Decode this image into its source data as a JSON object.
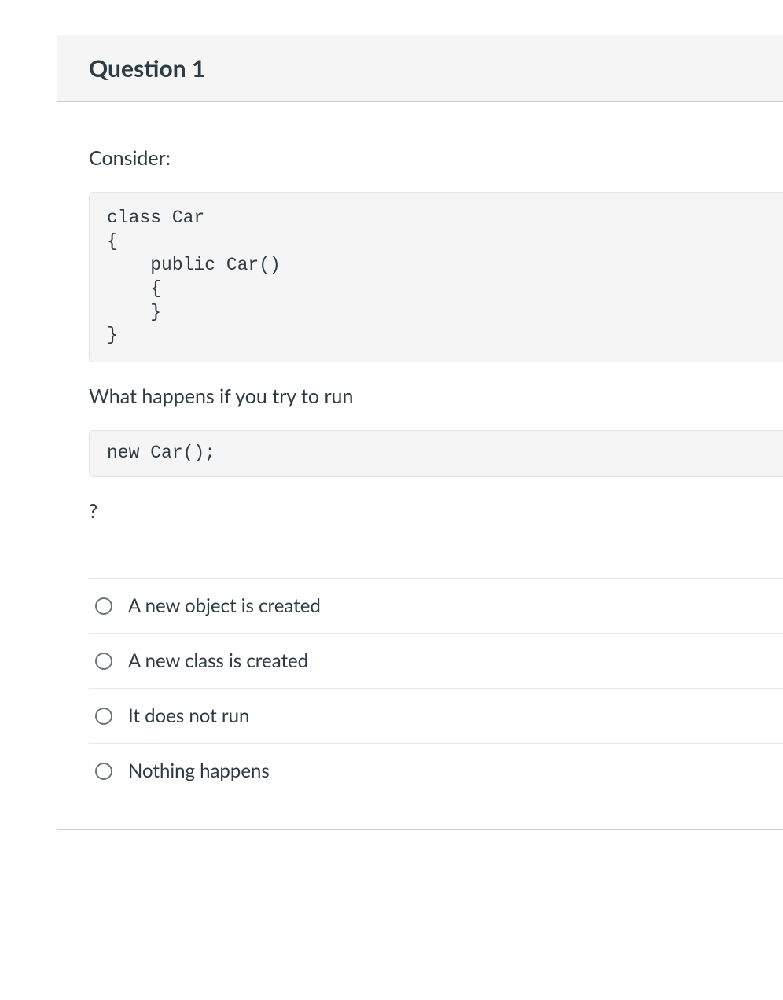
{
  "question": {
    "title": "Question 1",
    "intro": "Consider:",
    "code1": "class Car\n{\n    public Car()\n    {\n    }\n}",
    "followup": "What happens if you try to run",
    "code2": "new Car();",
    "qmark": "?",
    "options": [
      {
        "label": "A new object is created"
      },
      {
        "label": "A new class is created"
      },
      {
        "label": "It does not run"
      },
      {
        "label": "Nothing happens"
      }
    ]
  }
}
